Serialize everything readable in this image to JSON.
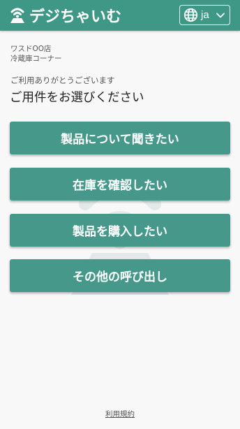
{
  "header": {
    "app_name": "デジちゃいむ",
    "logo_icon": "bell-signal-icon",
    "language": {
      "icon": "globe-icon",
      "selected": "ja",
      "chevron_icon": "chevron-down-icon"
    }
  },
  "location": {
    "store": "ワスドOO店",
    "area": "冷蔵庫コーナー"
  },
  "greeting": "ご利用ありがとうございます",
  "prompt": "ご用件をお選びください",
  "options": [
    {
      "label": "製品について聞きたい"
    },
    {
      "label": "在庫を確認したい"
    },
    {
      "label": "製品を購入したい"
    },
    {
      "label": "その他の呼び出し"
    }
  ],
  "footer": {
    "terms_link": "利用規約"
  },
  "colors": {
    "primary": "#3f9886",
    "button": "#45988a",
    "background": "#f8f8f8"
  }
}
